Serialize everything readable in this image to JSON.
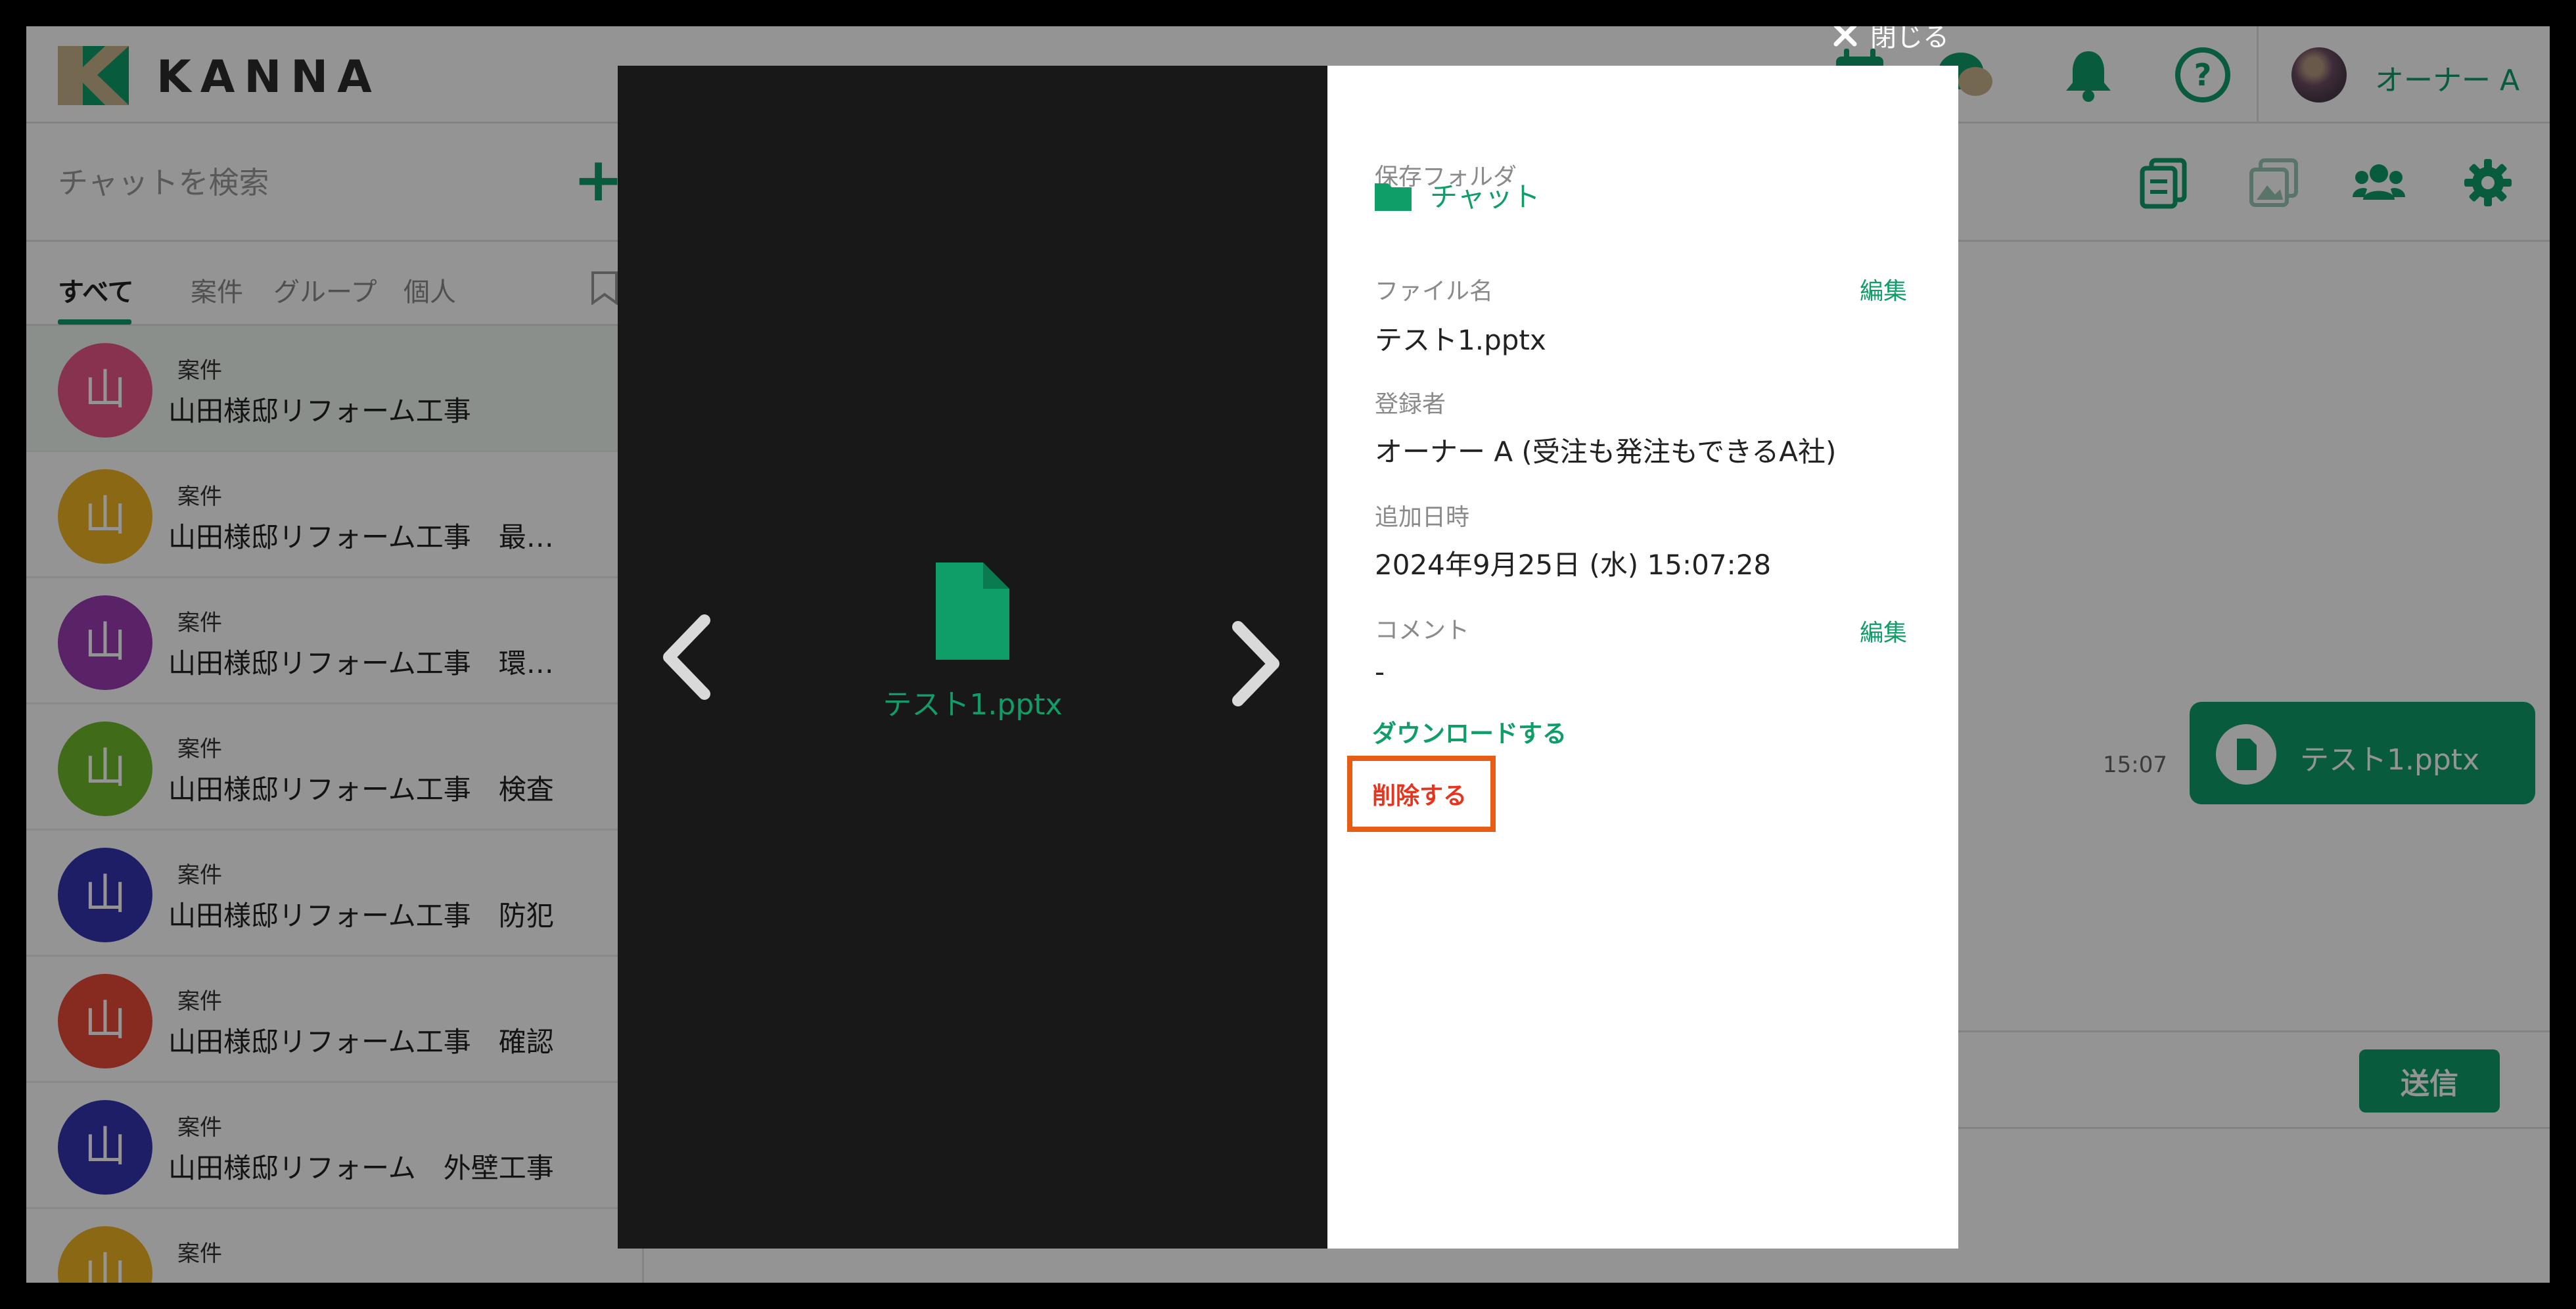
{
  "app": {
    "brand": "KANNA",
    "user_name": "オーナー A"
  },
  "sidebar": {
    "search_placeholder": "チャットを検索",
    "add_label": "+",
    "tabs": [
      {
        "label": "すべて",
        "active": true
      },
      {
        "label": "案件",
        "active": false
      },
      {
        "label": "グループ",
        "active": false
      },
      {
        "label": "個人",
        "active": false
      }
    ],
    "chats": [
      {
        "initial": "山",
        "type": "案件",
        "title": "山田様邸リフォーム工事",
        "color": "#e8588a",
        "selected": true
      },
      {
        "initial": "山",
        "type": "案件",
        "title": "山田様邸リフォーム工事　最…",
        "color": "#f0b321",
        "selected": false
      },
      {
        "initial": "山",
        "type": "案件",
        "title": "山田様邸リフォーム工事　環…",
        "color": "#9b3bb2",
        "selected": false
      },
      {
        "initial": "山",
        "type": "案件",
        "title": "山田様邸リフォーム工事　検査",
        "color": "#6eb82c",
        "selected": false
      },
      {
        "initial": "山",
        "type": "案件",
        "title": "山田様邸リフォーム工事　防犯",
        "color": "#3434b0",
        "selected": false
      },
      {
        "initial": "山",
        "type": "案件",
        "title": "山田様邸リフォーム工事　確認",
        "color": "#e84b3a",
        "selected": false
      },
      {
        "initial": "山",
        "type": "案件",
        "title": "山田様邸リフォーム　外壁工事",
        "color": "#3434b0",
        "selected": false
      },
      {
        "initial": "山",
        "type": "案件",
        "title": "",
        "color": "#f0b321",
        "selected": false
      }
    ]
  },
  "main": {
    "message_time": "15:07",
    "message_file": "テスト1.pptx",
    "send_label": "送信"
  },
  "modal": {
    "close_label": "閉じる",
    "preview_file_name": "テスト1.pptx",
    "folder_label": "保存フォルダ",
    "folder_name": "チャット",
    "filename_label": "ファイル名",
    "filename_value": "テスト1.pptx",
    "edit_label": "編集",
    "registrant_label": "登録者",
    "registrant_value": "オーナー A (受注も発注もできるA社)",
    "added_label": "追加日時",
    "added_value": "2024年9月25日 (水) 15:07:28",
    "comment_label": "コメント",
    "comment_value": "-",
    "download_label": "ダウンロードする",
    "delete_label": "削除する"
  },
  "colors": {
    "accent": "#0f9d68",
    "danger": "#e8341c",
    "highlight": "#e85d14"
  }
}
